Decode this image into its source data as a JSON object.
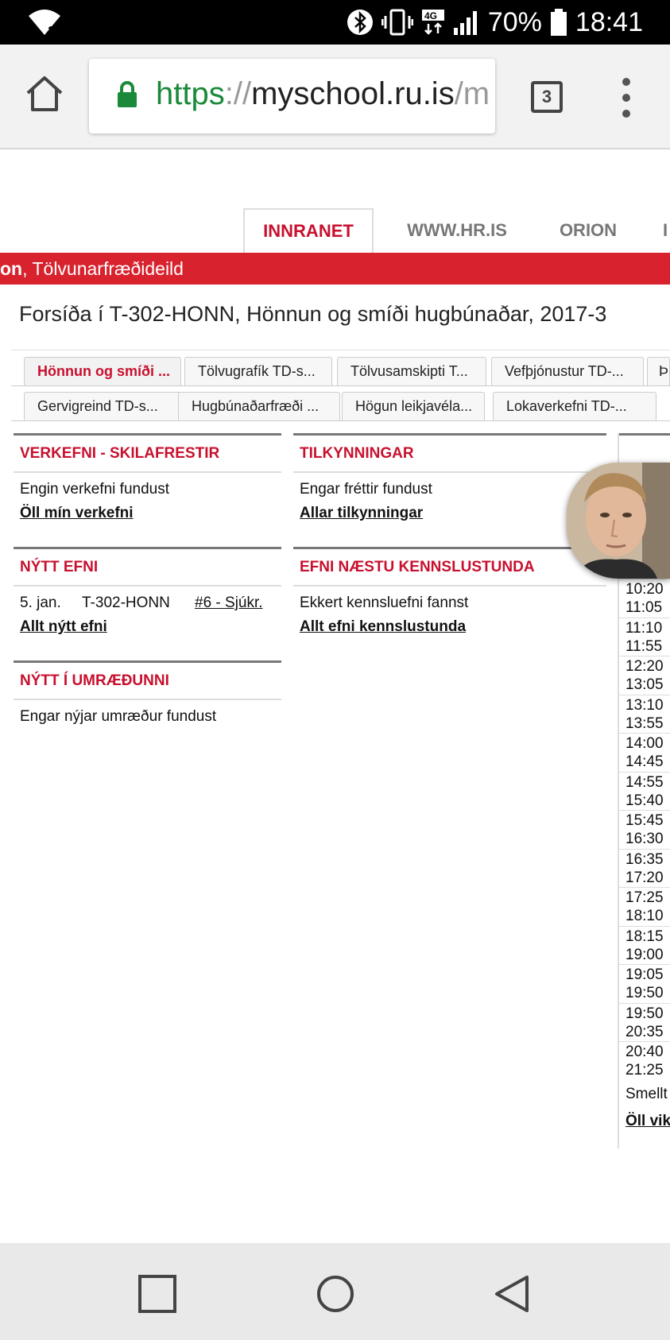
{
  "status_bar": {
    "battery": "70%",
    "time": "18:41",
    "network": "4G"
  },
  "browser": {
    "url_scheme": "https",
    "url_sep": "://",
    "url_host": "myschool.ru.is",
    "url_path": "/m",
    "tab_count": "3"
  },
  "site_nav": {
    "tabs": [
      "INNRANET",
      "WWW.HR.IS",
      "ORION",
      "I"
    ]
  },
  "banner": {
    "bold": "on",
    "text": ", Tölvunarfræðideild"
  },
  "page_title": "Forsíða í T-302-HONN, Hönnun og smíði hugbúnaðar, 2017-3",
  "course_tabs_row1": [
    "Hönnun og smíði ...",
    "Tölvugrafík TD-s...",
    "Tölvusamskipti T...",
    "Vefþjónustur TD-...",
    "Þr"
  ],
  "course_tabs_row2": [
    "Gervigreind TD-s...",
    "Hugbúnaðarfræði ...",
    "Högun leikjavéla...",
    "Lokaverkefni TD-..."
  ],
  "panels": {
    "verkefni": {
      "title": "VERKEFNI - SKILAFRESTIR",
      "empty": "Engin verkefni fundust",
      "link": "Öll mín verkefni"
    },
    "tilkynningar": {
      "title": "TILKYNNINGAR",
      "empty": "Engar fréttir fundust",
      "link": "Allar tilkynningar"
    },
    "nytt_efni": {
      "title": "NÝTT EFNI",
      "row": {
        "date": "5. jan.",
        "course": "T-302-HONN",
        "item": "#6 - Sjúkr."
      },
      "link": "Allt nýtt efni"
    },
    "efni_naestu": {
      "title": "EFNI NÆSTU KENNSLUSTUNDA",
      "empty": "Ekkert kennsluefni fannst",
      "link": "Allt efni kennslustunda"
    },
    "umraedur": {
      "title": "NÝTT Í UMRÆÐUNNI",
      "empty": "Engar nýjar umræður fundust"
    }
  },
  "timetable": {
    "slots": [
      [
        "10:20",
        "11:05"
      ],
      [
        "11:10",
        "11:55"
      ],
      [
        "12:20",
        "13:05"
      ],
      [
        "13:10",
        "13:55"
      ],
      [
        "14:00",
        "14:45"
      ],
      [
        "14:55",
        "15:40"
      ],
      [
        "15:45",
        "16:30"
      ],
      [
        "16:35",
        "17:20"
      ],
      [
        "17:25",
        "18:10"
      ],
      [
        "18:15",
        "19:00"
      ],
      [
        "19:05",
        "19:50"
      ],
      [
        "19:50",
        "20:35"
      ],
      [
        "20:40",
        "21:25"
      ]
    ],
    "note": "Smellt",
    "link": "Öll vik"
  }
}
